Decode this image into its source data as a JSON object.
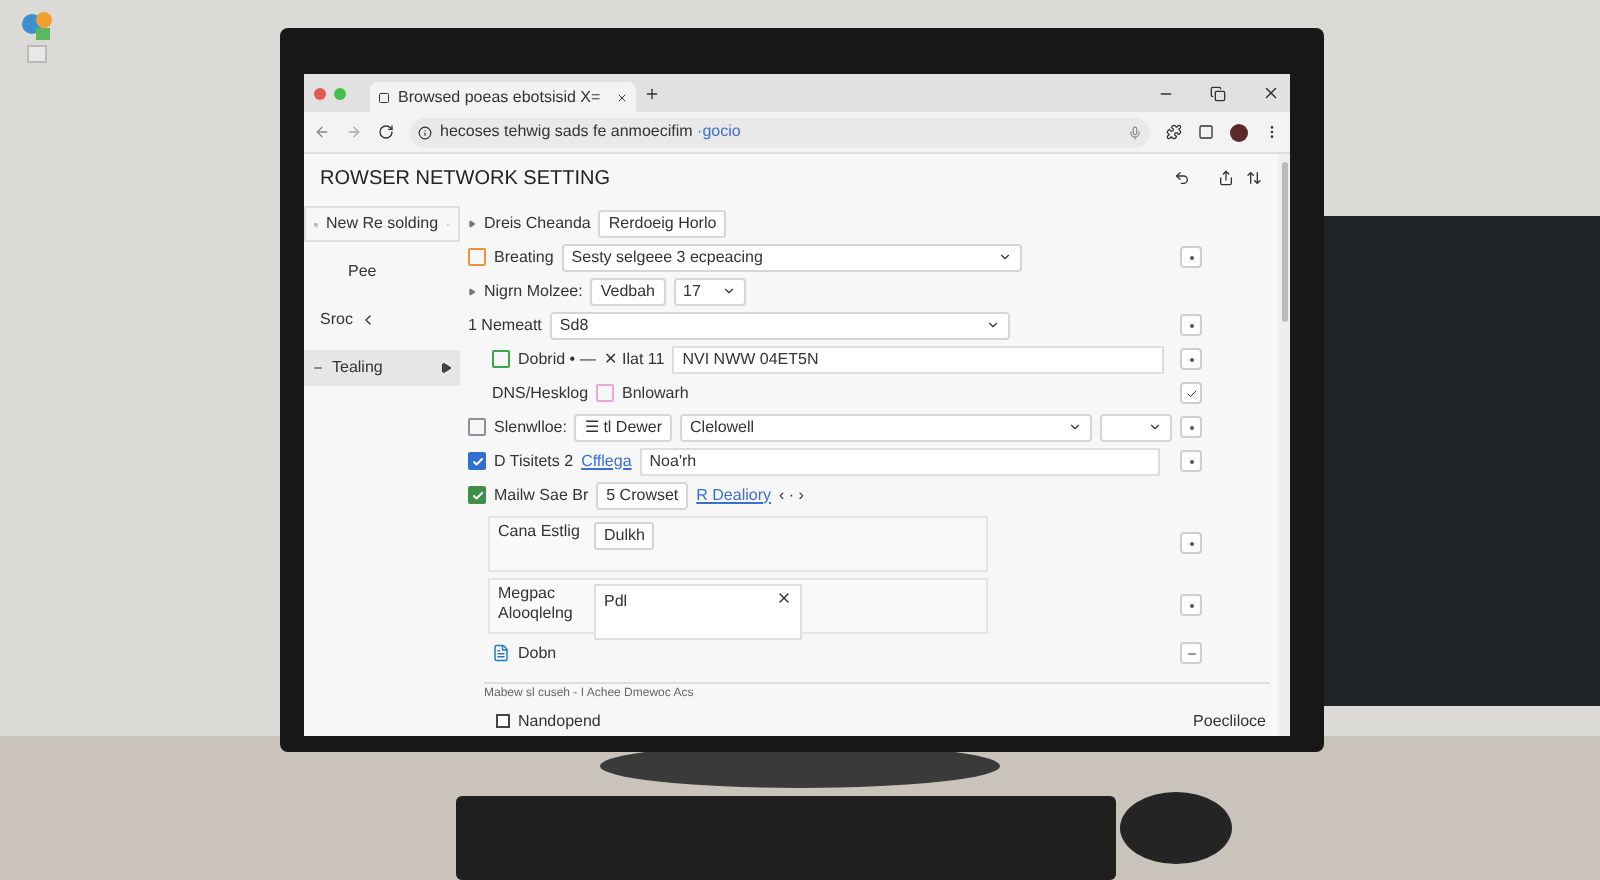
{
  "window": {
    "tab_title": "Browsed poeas ebotsisid X=",
    "url": "hecoses tehwig sads fe anmoecifim",
    "url_suffix": "·gocio"
  },
  "page": {
    "title": "ROWSER NETWORK SETTING"
  },
  "sidebar": {
    "items": [
      {
        "label": "New Re solding",
        "kind": "dropdown",
        "selected": false
      },
      {
        "label": "Pee",
        "kind": "plain",
        "selected": false
      },
      {
        "label": "Sroc",
        "kind": "back",
        "selected": false
      },
      {
        "label": "Tealing",
        "kind": "expand",
        "selected": true
      }
    ]
  },
  "rows": [
    {
      "kind": "field",
      "collapsible": true,
      "label": "Dreis Cheanda",
      "fields": [
        {
          "kind": "chip",
          "value": "Rerdoeig Horlo"
        }
      ]
    },
    {
      "kind": "field",
      "box": {
        "color": "#f0903a",
        "checked": false
      },
      "label": "Breating",
      "fields": [
        {
          "kind": "select-wide",
          "value": "Sesty selgeee 3 ecpeacing"
        }
      ],
      "action": {
        "kind": "dot"
      }
    },
    {
      "kind": "field",
      "collapsible": true,
      "label": "Nigrn Molzee:",
      "fields": [
        {
          "kind": "chip",
          "value": "Vedbah"
        },
        {
          "kind": "select",
          "value": "17"
        }
      ]
    },
    {
      "kind": "field",
      "label": "1  Nemeatt",
      "fields": [
        {
          "kind": "select-wide",
          "value": "Sd8"
        }
      ],
      "action": {
        "kind": "dot"
      }
    },
    {
      "kind": "subfield",
      "box": {
        "color": "#3aa845",
        "checked": false
      },
      "label": "Dobrid • —",
      "fields": [
        {
          "kind": "text",
          "value": "✕ Ilat 11"
        },
        {
          "kind": "textarea",
          "value": "NVI NWW 04ET5N"
        }
      ],
      "action": {
        "kind": "dot"
      }
    },
    {
      "kind": "subfield",
      "label": "DNS/Hesklog",
      "box": {
        "color": "#e8a8d8",
        "checked": false
      },
      "box_after": true,
      "fields": [
        {
          "kind": "text",
          "value": "Bnlowarh"
        }
      ],
      "action": {
        "kind": "check"
      }
    },
    {
      "kind": "field",
      "box": {
        "color": "#8a8f96",
        "checked": false
      },
      "label": "Slenwlloe:",
      "fields": [
        {
          "kind": "chip",
          "value": "☰ tl Dewer"
        },
        {
          "kind": "select-wide",
          "value": "Clelowell"
        },
        {
          "kind": "select"
        }
      ],
      "action": {
        "kind": "dot"
      }
    },
    {
      "kind": "field",
      "box": {
        "color": "#2f6fd0",
        "checked": true
      },
      "label": "D Tisitets 2",
      "fields": [
        {
          "kind": "link",
          "value": "Cfflega"
        },
        {
          "kind": "input",
          "value": "Noa'rh"
        }
      ],
      "action": {
        "kind": "dot"
      }
    },
    {
      "kind": "field",
      "box": {
        "color": "#3f8f4a",
        "checked": true
      },
      "label": "Mailw Sae Br",
      "fields": [
        {
          "kind": "chip",
          "value": "5 Crowset"
        },
        {
          "kind": "link",
          "value": "R Dealiory"
        },
        {
          "kind": "text",
          "value": "‹   ·  ›"
        }
      ]
    },
    {
      "kind": "card",
      "label": "Cana Estlig",
      "fields": [
        {
          "kind": "chip",
          "value": "Dulkh"
        }
      ],
      "action": {
        "kind": "dot"
      }
    },
    {
      "kind": "card",
      "label": "Megpac Alooqlelng",
      "fields": [
        {
          "kind": "clear-input",
          "value": "Pdl"
        }
      ],
      "action": {
        "kind": "dot"
      }
    },
    {
      "kind": "subfield",
      "label": "Dobn",
      "icon": true,
      "fields": [],
      "action": {
        "kind": "minus"
      }
    }
  ],
  "status_bar": {
    "text": "Mabew sl cuseh - I Achee Dmewoc Acs"
  },
  "footer": {
    "checkbox": {
      "label": "Nandopend",
      "checked": false
    },
    "right_text": "Poecliloce"
  }
}
